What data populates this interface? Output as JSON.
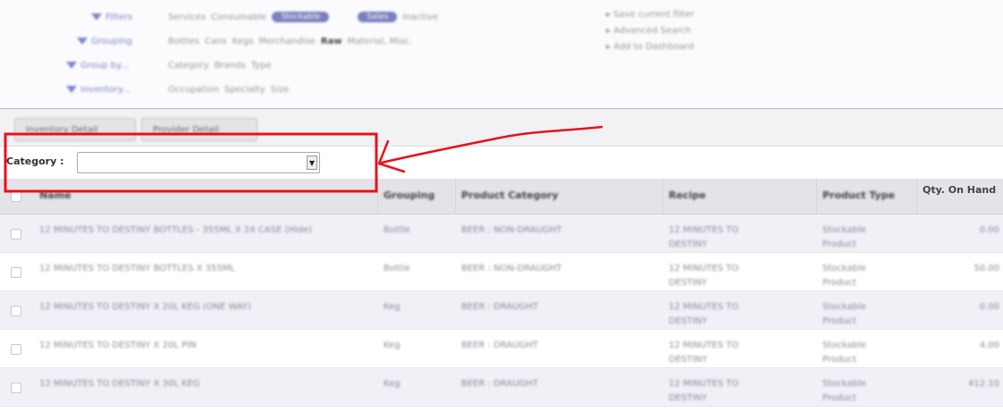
{
  "filters": {
    "rows": [
      {
        "label": "Filters",
        "items": [
          "Services",
          "Consumable"
        ],
        "pills": [
          "Stockable",
          "Sales"
        ],
        "trailing": "Inactive"
      },
      {
        "label": "Grouping",
        "items": [
          "Bottles",
          "Cans",
          "Kegs",
          "Merchandise"
        ],
        "bold": "Raw",
        "trailing": "Material, Misc."
      },
      {
        "label": "Group by...",
        "items": [
          "Category",
          "Brands",
          "Type"
        ]
      },
      {
        "label": "Inventory...",
        "items": [
          "Occupation",
          "Specialty",
          "Size"
        ]
      }
    ],
    "side_menu": [
      "Save current filter",
      "Advanced Search",
      "Add to Dashboard"
    ]
  },
  "buttons": [
    "Inventory Detail",
    "Provider Detail"
  ],
  "category": {
    "label": "Category :",
    "value": ""
  },
  "table": {
    "headers": [
      "Name",
      "Grouping",
      "Product Category",
      "Recipe",
      "Product Type",
      "Qty. On Hand"
    ],
    "rows": [
      {
        "name": "12 MINUTES TO DESTINY BOTTLES - 355ML X 24 CASE (Hide)",
        "grouping": "Bottle",
        "category": "BEER : NON-DRAUGHT",
        "recipe": "12 MINUTES TO DESTINY",
        "type": "Stockable Product",
        "qty": "0.00"
      },
      {
        "name": "12 MINUTES TO DESTINY BOTTLES X 355ML",
        "grouping": "Bottle",
        "category": "BEER : NON-DRAUGHT",
        "recipe": "12 MINUTES TO DESTINY",
        "type": "Stockable Product",
        "qty": "50.00"
      },
      {
        "name": "12 MINUTES TO DESTINY X 20L KEG (ONE WAY)",
        "grouping": "Keg",
        "category": "BEER : DRAUGHT",
        "recipe": "12 MINUTES TO DESTINY",
        "type": "Stockable Product",
        "qty": "0.00"
      },
      {
        "name": "12 MINUTES TO DESTINY X 20L PIN",
        "grouping": "Keg",
        "category": "BEER : DRAUGHT",
        "recipe": "12 MINUTES TO DESTINY",
        "type": "Stockable Product",
        "qty": "4.00"
      },
      {
        "name": "12 MINUTES TO DESTINY X 30L KEG",
        "grouping": "Keg",
        "category": "BEER : DRAUGHT",
        "recipe": "12 MINUTES TO DESTINY",
        "type": "Stockable Product",
        "qty": "412.10"
      }
    ]
  },
  "colors": {
    "annotation": "#e8111a",
    "accent": "#7b7fbf"
  }
}
